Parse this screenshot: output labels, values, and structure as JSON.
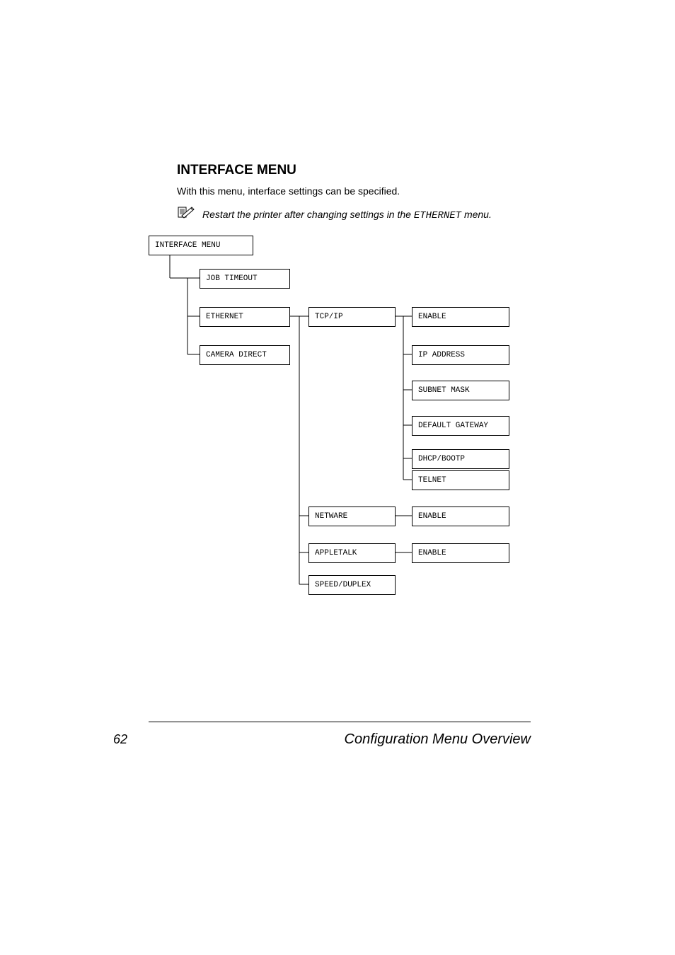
{
  "heading": "INTERFACE MENU",
  "intro": "With this menu, interface settings can be specified.",
  "note": {
    "prefix": "Restart the printer after changing settings in the ",
    "mono": "ETHERNET",
    "suffix": " menu."
  },
  "tree": {
    "root": "INTERFACE MENU",
    "level1": {
      "job_timeout": "JOB TIMEOUT",
      "ethernet": "ETHERNET",
      "camera_direct": "CAMERA DIRECT"
    },
    "level2": {
      "tcp_ip": "TCP/IP",
      "netware": "NETWARE",
      "appletalk": "APPLETALK",
      "speed_duplex": "SPEED/DUPLEX"
    },
    "level3": {
      "enable1": "ENABLE",
      "ip_address": "IP ADDRESS",
      "subnet_mask": "SUBNET MASK",
      "default_gateway": "DEFAULT GATEWAY",
      "dhcp_bootp": "DHCP/BOOTP",
      "telnet": "TELNET",
      "enable2": "ENABLE",
      "enable3": "ENABLE"
    }
  },
  "footer": {
    "page_number": "62",
    "section": "Configuration Menu Overview"
  }
}
